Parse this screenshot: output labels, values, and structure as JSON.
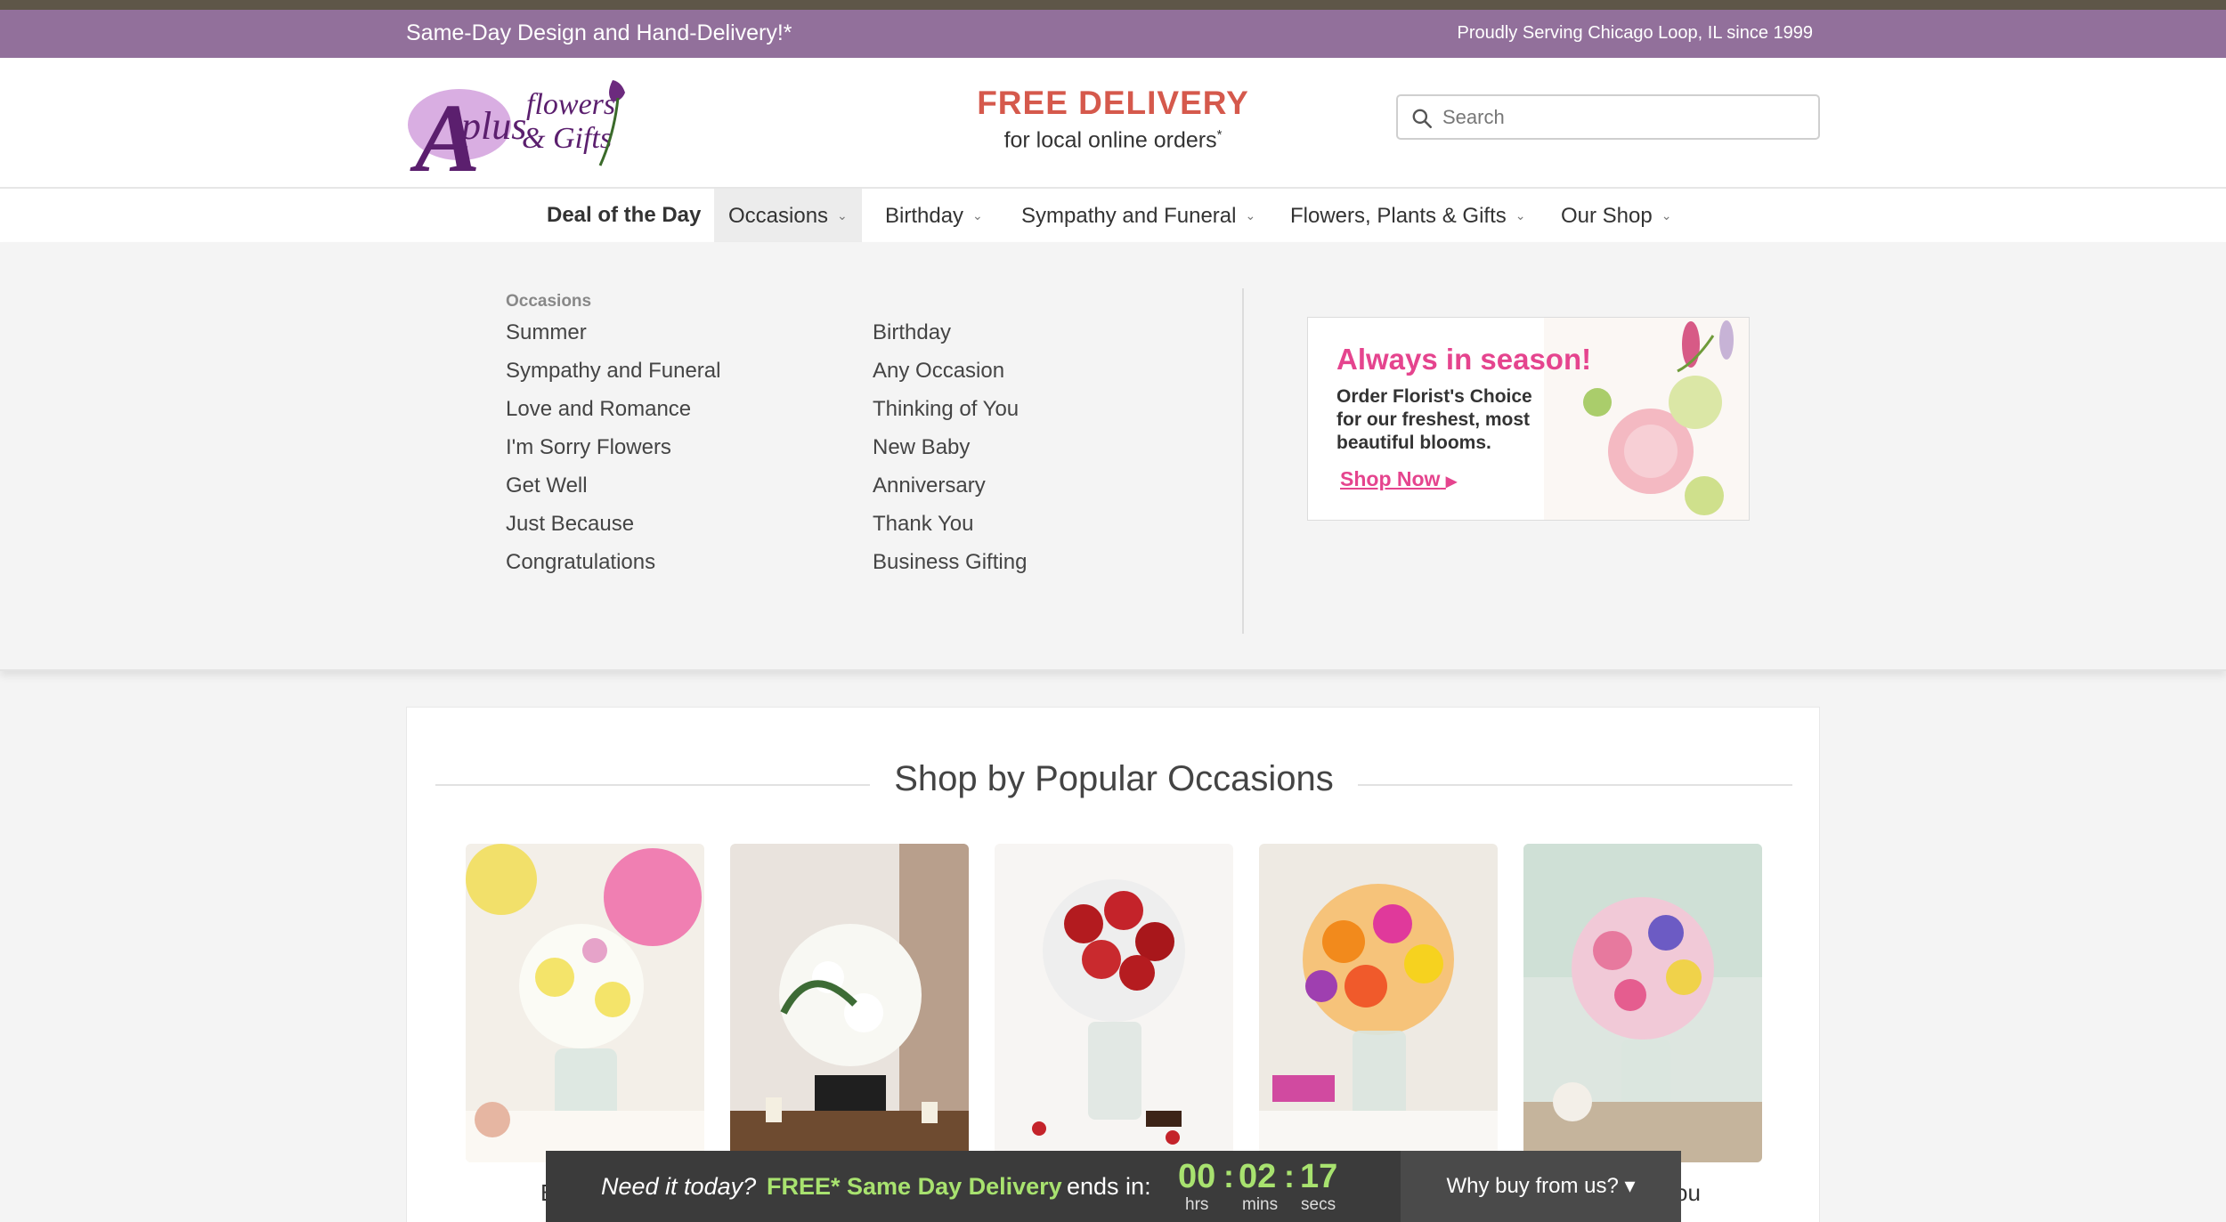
{
  "promo_bar": {
    "left_text": "Same-Day Design and Hand-Delivery!*",
    "right_text": "Proudly Serving Chicago Loop, IL since 1999"
  },
  "header": {
    "logo_text": "Aplus flowers & Gifts",
    "free_delivery_title": "FREE DELIVERY",
    "free_delivery_sub": "for local online orders",
    "free_delivery_mark": "*",
    "search_placeholder": "Search"
  },
  "nav": {
    "items": [
      {
        "label": "Deal of the Day"
      },
      {
        "label": "Occasions"
      },
      {
        "label": "Birthday"
      },
      {
        "label": "Sympathy and Funeral"
      },
      {
        "label": "Flowers, Plants & Gifts"
      },
      {
        "label": "Our Shop"
      }
    ]
  },
  "mega_menu": {
    "heading": "Occasions",
    "col1": [
      "Summer",
      "Sympathy and Funeral",
      "Love and Romance",
      "I'm Sorry Flowers",
      "Get Well",
      "Just Because",
      "Congratulations"
    ],
    "col2": [
      "Birthday",
      "Any Occasion",
      "Thinking of You",
      "New Baby",
      "Anniversary",
      "Thank You",
      "Business Gifting"
    ],
    "promo": {
      "title": "Always in season!",
      "body": "Order Florist's Choice for our freshest, most beautiful blooms.",
      "link": "Shop Now"
    }
  },
  "section": {
    "title": "Shop by Popular Occasions",
    "tiles": [
      {
        "label": "B"
      },
      {
        "label": ""
      },
      {
        "label": ""
      },
      {
        "label": ""
      },
      {
        "label": "ou"
      }
    ]
  },
  "sticky_bar": {
    "need": "Need it today?",
    "free": "FREE* Same Day Delivery",
    "ends": "ends in:",
    "hrs": "00",
    "mins": "02",
    "secs": "17",
    "hrs_label": "hrs",
    "mins_label": "mins",
    "secs_label": "secs",
    "colon": ":",
    "why": "Why buy from us? ▾"
  },
  "colors": {
    "promo_bar": "#92709b",
    "free_delivery": "#d5594c",
    "accent_pink": "#e5448e",
    "countdown": "#a8e26f"
  }
}
